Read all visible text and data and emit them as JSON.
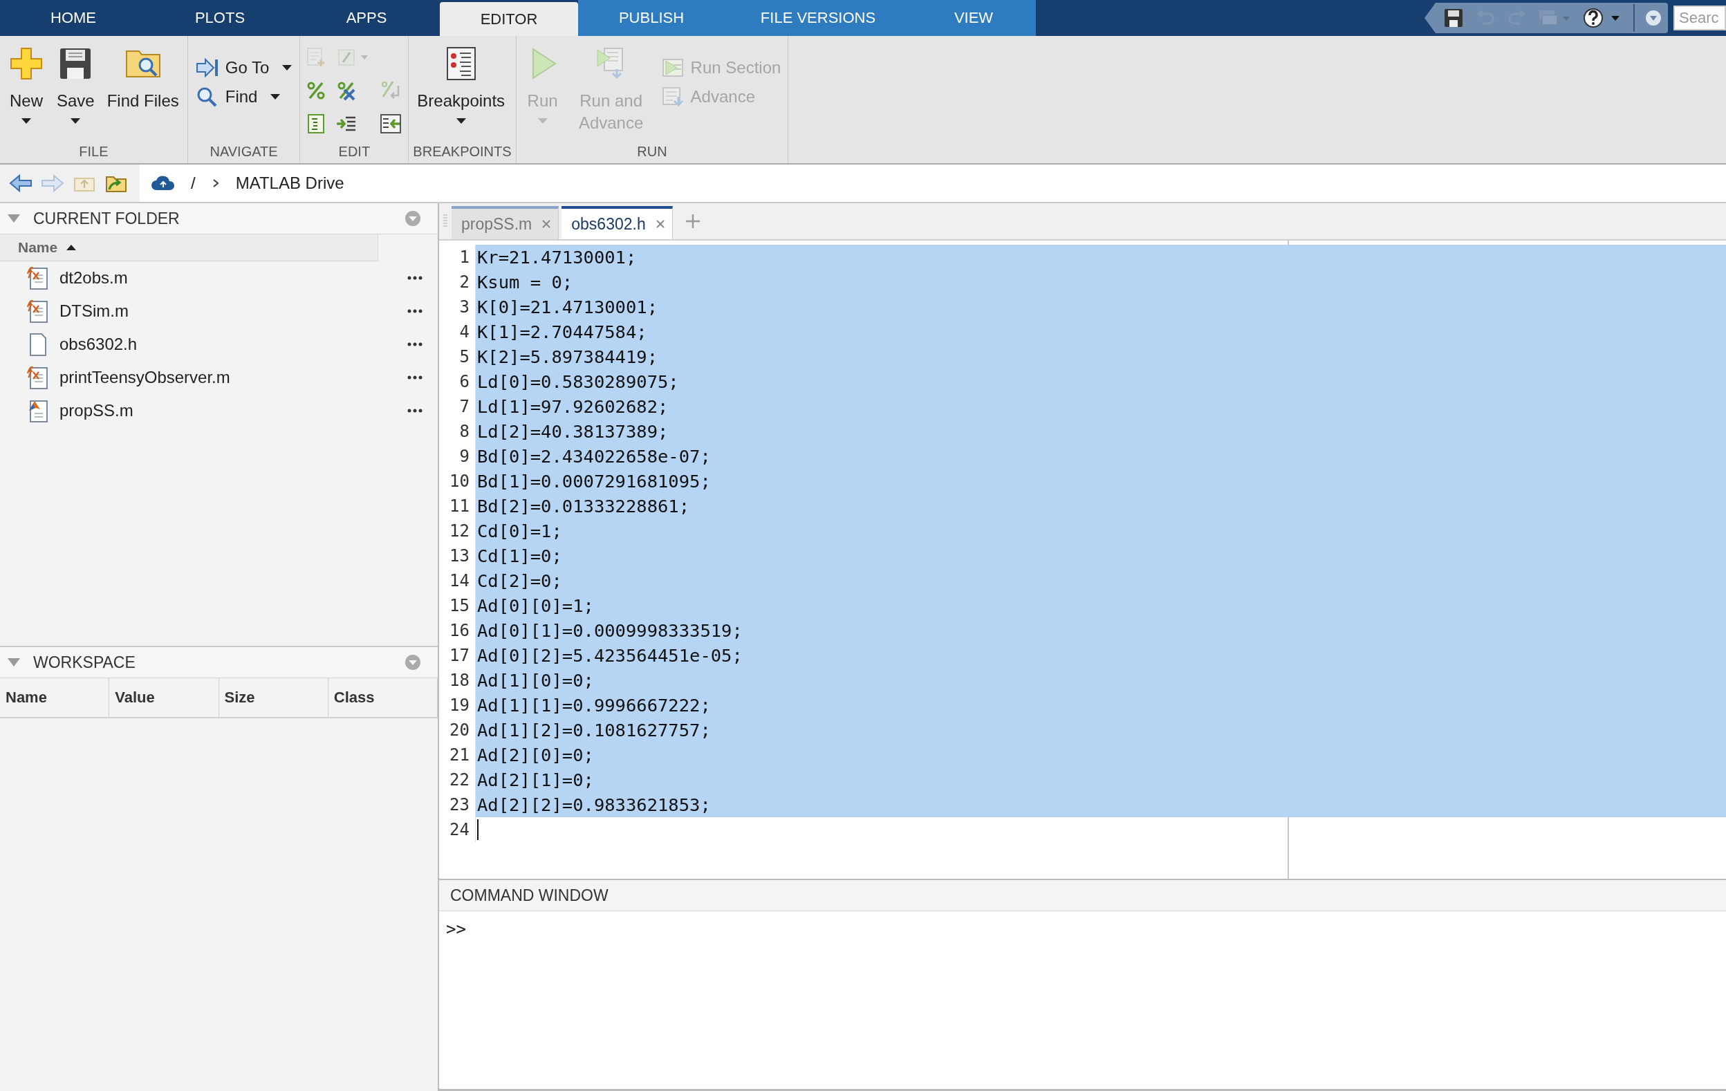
{
  "tabs": [
    {
      "label": "HOME",
      "selected": false,
      "context": false
    },
    {
      "label": "PLOTS",
      "selected": false,
      "context": false
    },
    {
      "label": "APPS",
      "selected": false,
      "context": false
    },
    {
      "label": "EDITOR",
      "selected": true,
      "context": true
    },
    {
      "label": "PUBLISH",
      "selected": false,
      "context": true
    },
    {
      "label": "FILE VERSIONS",
      "selected": false,
      "context": true
    },
    {
      "label": "VIEW",
      "selected": false,
      "context": true
    }
  ],
  "search": {
    "placeholder": "Searc"
  },
  "toolbar": [
    {
      "title": "FILE",
      "kind": "buttons",
      "items": [
        {
          "label": "New",
          "kind": "large",
          "menu": true,
          "disabled": false
        },
        {
          "label": "Save",
          "kind": "large",
          "menu": true,
          "disabled": false
        },
        {
          "label": "Find Files",
          "kind": "large",
          "menu": false,
          "disabled": false
        }
      ]
    },
    {
      "title": "NAVIGATE",
      "kind": "buttons",
      "items": [
        {
          "label": "Go To",
          "kind": "small",
          "menu": true,
          "disabled": false
        },
        {
          "label": "Find",
          "kind": "small",
          "menu": true,
          "disabled": false
        }
      ]
    },
    {
      "title": "EDIT",
      "kind": "icons"
    },
    {
      "title": "BREAKPOINTS",
      "kind": "buttons",
      "items": [
        {
          "label": "Breakpoints",
          "kind": "large",
          "menu": true,
          "disabled": false
        }
      ]
    },
    {
      "title": "RUN",
      "kind": "buttons",
      "items": [
        {
          "label": "Run",
          "kind": "large",
          "menu": true,
          "disabled": true
        },
        {
          "label": "Run and Advance",
          "kind": "large",
          "menu": false,
          "disabled": true
        },
        {
          "label": "Run Section",
          "kind": "small",
          "menu": false,
          "disabled": true
        },
        {
          "label": "Advance",
          "kind": "small",
          "menu": false,
          "disabled": true
        }
      ]
    }
  ],
  "address": {
    "segments": [
      "/",
      "MATLAB Drive"
    ]
  },
  "current_folder": {
    "title": "CURRENT FOLDER",
    "column": "Name",
    "files": [
      {
        "name": "dt2obs.m",
        "kind": "function"
      },
      {
        "name": "DTSim.m",
        "kind": "function"
      },
      {
        "name": "obs6302.h",
        "kind": "file"
      },
      {
        "name": "printTeensyObserver.m",
        "kind": "function"
      },
      {
        "name": "propSS.m",
        "kind": "script"
      }
    ]
  },
  "workspace": {
    "title": "WORKSPACE",
    "columns": [
      "Name",
      "Value",
      "Size",
      "Class"
    ]
  },
  "editor": {
    "tabs": [
      {
        "label": "propSS.m",
        "selected": false
      },
      {
        "label": "obs6302.h",
        "selected": true
      }
    ],
    "lines": [
      {
        "n": "1",
        "text": "Kr=21.47130001;",
        "selected": true
      },
      {
        "n": "2",
        "text": "Ksum = 0;",
        "selected": true
      },
      {
        "n": "3",
        "text": "K[0]=21.47130001;",
        "selected": true
      },
      {
        "n": "4",
        "text": "K[1]=2.70447584;",
        "selected": true
      },
      {
        "n": "5",
        "text": "K[2]=5.897384419;",
        "selected": true
      },
      {
        "n": "6",
        "text": "Ld[0]=0.5830289075;",
        "selected": true
      },
      {
        "n": "7",
        "text": "Ld[1]=97.92602682;",
        "selected": true
      },
      {
        "n": "8",
        "text": "Ld[2]=40.38137389;",
        "selected": true
      },
      {
        "n": "9",
        "text": "Bd[0]=2.434022658e-07;",
        "selected": true
      },
      {
        "n": "10",
        "text": "Bd[1]=0.0007291681095;",
        "selected": true
      },
      {
        "n": "11",
        "text": "Bd[2]=0.01333228861;",
        "selected": true
      },
      {
        "n": "12",
        "text": "Cd[0]=1;",
        "selected": true
      },
      {
        "n": "13",
        "text": "Cd[1]=0;",
        "selected": true
      },
      {
        "n": "14",
        "text": "Cd[2]=0;",
        "selected": true
      },
      {
        "n": "15",
        "text": "Ad[0][0]=1;",
        "selected": true
      },
      {
        "n": "16",
        "text": "Ad[0][1]=0.0009998333519;",
        "selected": true
      },
      {
        "n": "17",
        "text": "Ad[0][2]=5.423564451e-05;",
        "selected": true
      },
      {
        "n": "18",
        "text": "Ad[1][0]=0;",
        "selected": true
      },
      {
        "n": "19",
        "text": "Ad[1][1]=0.9996667222;",
        "selected": true
      },
      {
        "n": "20",
        "text": "Ad[1][2]=0.1081627757;",
        "selected": true
      },
      {
        "n": "21",
        "text": "Ad[2][0]=0;",
        "selected": true
      },
      {
        "n": "22",
        "text": "Ad[2][1]=0;",
        "selected": true
      },
      {
        "n": "23",
        "text": "Ad[2][2]=0.9833621853;",
        "selected": true
      },
      {
        "n": "24",
        "selected": false,
        "cursor": true
      }
    ]
  },
  "command_window": {
    "title": "COMMAND WINDOW",
    "prompt": ">>"
  }
}
